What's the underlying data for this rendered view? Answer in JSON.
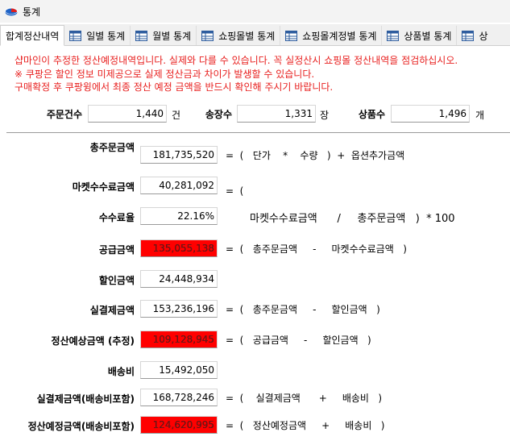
{
  "window": {
    "title": "통계",
    "app_icon": "pie-chart-icon"
  },
  "tabs": [
    {
      "label": "합계정산내역",
      "icon": ""
    },
    {
      "label": "일별 통계",
      "icon": "table-icon"
    },
    {
      "label": "월별 통계",
      "icon": "table-icon"
    },
    {
      "label": "쇼핑몰별 통계",
      "icon": "table-icon"
    },
    {
      "label": "쇼핑몰계정별 통계",
      "icon": "table-icon"
    },
    {
      "label": "상품별 통계",
      "icon": "table-icon"
    },
    {
      "label": "상",
      "icon": "table-icon"
    }
  ],
  "notice": [
    "샵마인이 추정한 정산예정내역입니다. 실제와 다를 수 있습니다. 꼭 실정산시 쇼핑몰 정산내역을 점검하십시오.",
    "※ 쿠팡은 할인 정보 미제공으로 실제 정산금과 차이가 발생할 수 있습니다.",
    "구매확정 후 쿠팡윙에서 최종 정산 예정 금액을 반드시 확인해 주시기 바랍니다."
  ],
  "summary": {
    "orders": {
      "label": "주문건수",
      "value": "1,440",
      "unit": "건"
    },
    "invoices": {
      "label": "송장수",
      "value": "1,331",
      "unit": "장"
    },
    "products": {
      "label": "상품수",
      "value": "1,496",
      "unit": "개"
    }
  },
  "rows": {
    "total_order": {
      "label": "총주문금액",
      "value": "181,735,520",
      "formula": "=  (   단가    *    수량   )  +  옵션추가금액"
    },
    "market_fee": {
      "label": "마켓수수료금액",
      "value": "40,281,092",
      "formula": "=  ("
    },
    "fee_rate": {
      "label": "수수료율",
      "value": "22.16%",
      "formula": "마켓수수료금액      /     총주문금액   )  * 100"
    },
    "supply": {
      "label": "공급금액",
      "value": "135,055,138",
      "formula": "=  (   총주문금액     -     마켓수수료금액   )"
    },
    "discount": {
      "label": "할인금액",
      "value": "24,448,934",
      "formula": ""
    },
    "net_payment": {
      "label": "실결제금액",
      "value": "153,236,196",
      "formula": "=  (   총주문금액     -     할인금액   )"
    },
    "settle_est": {
      "label": "정산예상금액 (추정)",
      "value": "109,128,945",
      "formula": "=  (   공급금액     -     할인금액   )"
    },
    "shipping": {
      "label": "배송비",
      "value": "15,492,050",
      "formula": ""
    },
    "net_with_ship": {
      "label": "실결제금액(배송비포함)",
      "value": "168,728,246",
      "formula": "=  (    실결제금액      +     배송비   )"
    },
    "settle_with_ship": {
      "label": "정산예정금액(배송비포함)",
      "value": "124,620,995",
      "formula": "=  (   정산예정금액     +     배송비   )"
    }
  },
  "colors": {
    "highlight": "#ff0000",
    "notice": "#e8201f"
  }
}
